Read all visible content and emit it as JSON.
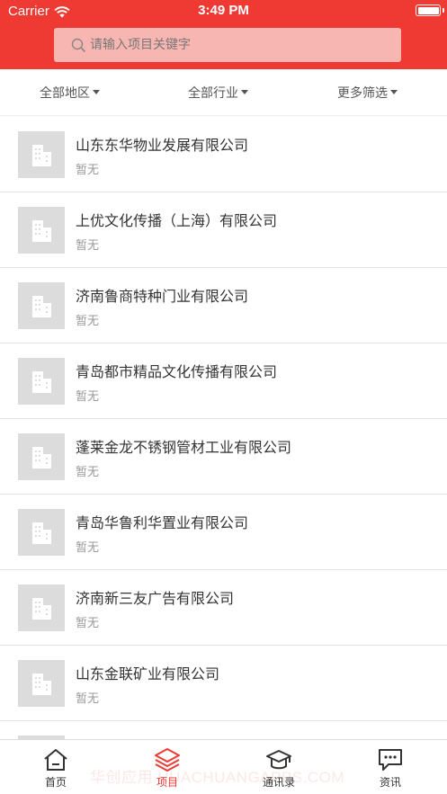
{
  "status_bar": {
    "carrier": "Carrier",
    "time": "3:49 PM"
  },
  "search": {
    "placeholder": "请输入项目关键字",
    "icon": "search-icon"
  },
  "filters": [
    {
      "label": "全部地区"
    },
    {
      "label": "全部行业"
    },
    {
      "label": "更多筛选"
    }
  ],
  "projects": [
    {
      "title": "山东东华物业发展有限公司",
      "subtitle": "暂无",
      "icon": "building-icon"
    },
    {
      "title": "上优文化传播（上海）有限公司",
      "subtitle": "暂无",
      "icon": "building-icon"
    },
    {
      "title": "济南鲁商特种门业有限公司",
      "subtitle": "暂无",
      "icon": "building-icon"
    },
    {
      "title": "青岛都市精品文化传播有限公司",
      "subtitle": "暂无",
      "icon": "building-icon"
    },
    {
      "title": "蓬莱金龙不锈钢管材工业有限公司",
      "subtitle": "暂无",
      "icon": "building-icon"
    },
    {
      "title": "青岛华鲁利华置业有限公司",
      "subtitle": "暂无",
      "icon": "building-icon"
    },
    {
      "title": "济南新三友广告有限公司",
      "subtitle": "暂无",
      "icon": "building-icon"
    },
    {
      "title": "山东金联矿业有限公司",
      "subtitle": "暂无",
      "icon": "building-icon"
    },
    {
      "title": "",
      "subtitle": "",
      "icon": "building-icon"
    }
  ],
  "tabbar": {
    "tabs": [
      {
        "label": "首页",
        "icon": "home-icon",
        "active": false
      },
      {
        "label": "项目",
        "icon": "layers-icon",
        "active": true
      },
      {
        "label": "通讯录",
        "icon": "graduation-cap-icon",
        "active": false
      },
      {
        "label": "资讯",
        "icon": "chat-icon",
        "active": false
      }
    ]
  },
  "watermark": "华创应用 HUACHUANGAPPS.COM",
  "colors": {
    "accent": "#ee3a33",
    "search_bg": "#f7b6b1",
    "thumb_bg": "#dcdcdc",
    "divider": "#e3e3e3"
  }
}
